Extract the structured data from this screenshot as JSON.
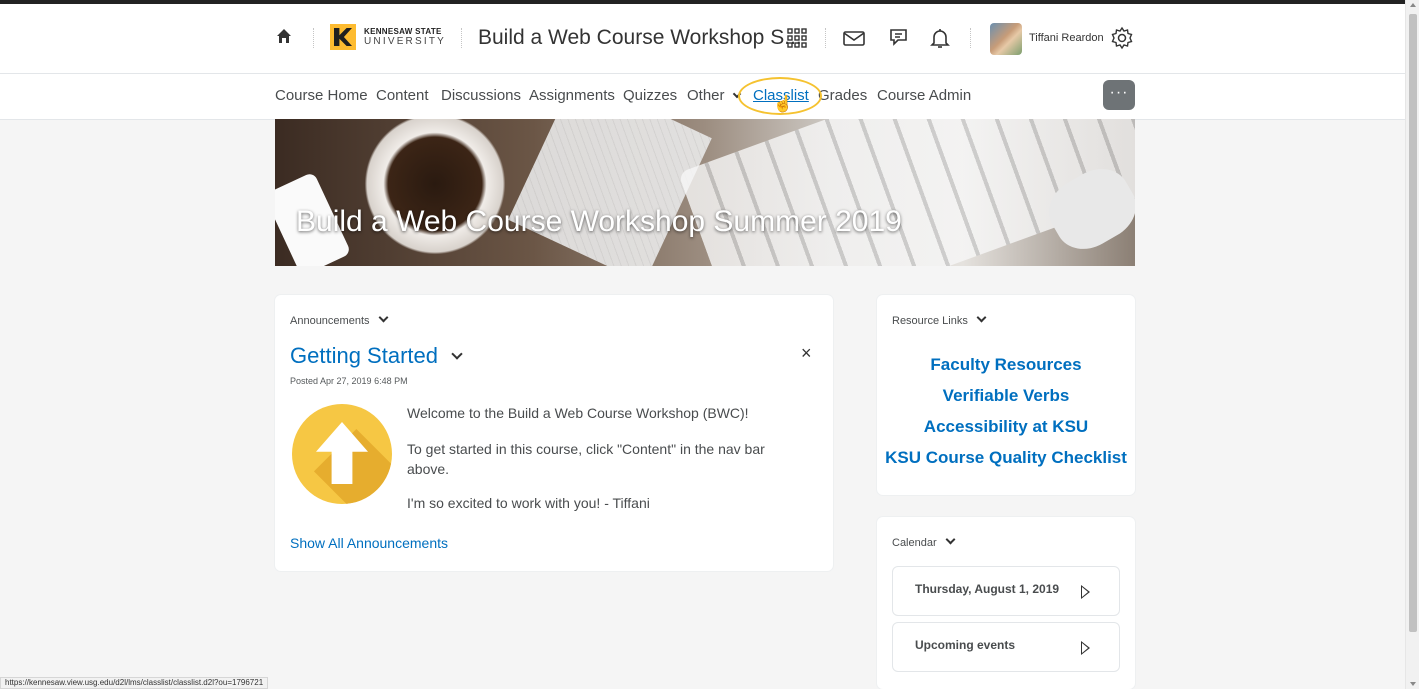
{
  "header": {
    "logo_line1": "KENNESAW STATE",
    "logo_line2": "UNIVERSITY",
    "course_title": "Build a Web Course Workshop S...",
    "username": "Tiffani Reardon"
  },
  "nav": {
    "items": [
      {
        "label": "Course Home"
      },
      {
        "label": "Content"
      },
      {
        "label": "Discussions"
      },
      {
        "label": "Assignments"
      },
      {
        "label": "Quizzes"
      },
      {
        "label": "Other"
      },
      {
        "label": "Classlist"
      },
      {
        "label": "Grades"
      },
      {
        "label": "Course Admin"
      }
    ],
    "more_label": "···"
  },
  "banner": {
    "title": "Build a Web Course Workshop Summer 2019"
  },
  "announcements": {
    "heading": "Announcements",
    "item_title": "Getting Started",
    "posted": "Posted Apr 27, 2019 6:48 PM",
    "close": "×",
    "body": [
      "Welcome to the Build a Web Course Workshop (BWC)!",
      "To get started in this course, click \"Content\" in the nav bar above.",
      "I'm so excited to work with you! - Tiffani"
    ],
    "show_all": "Show All Announcements"
  },
  "resources": {
    "heading": "Resource Links",
    "links": [
      {
        "label": "Faculty Resources"
      },
      {
        "label": "Verifiable Verbs"
      },
      {
        "label": "Accessibility at KSU"
      },
      {
        "label": "KSU Course Quality Checklist"
      }
    ]
  },
  "calendar": {
    "heading": "Calendar",
    "items": [
      {
        "label": "Thursday, August 1, 2019"
      },
      {
        "label": "Upcoming events"
      }
    ]
  },
  "status_bar": {
    "url": "https://kennesaw.view.usg.edu/d2l/lms/classlist/classlist.d2l?ou=1796721"
  },
  "icons": {
    "home": "home-icon",
    "waffle": "course-selector-icon",
    "message": "message-icon",
    "chat": "chat-icon",
    "bell": "notification-bell-icon",
    "settings": "gear-icon"
  },
  "colors": {
    "link": "#006fbf",
    "highlight": "#f5c230",
    "accent_logo": "#fdbb30"
  }
}
